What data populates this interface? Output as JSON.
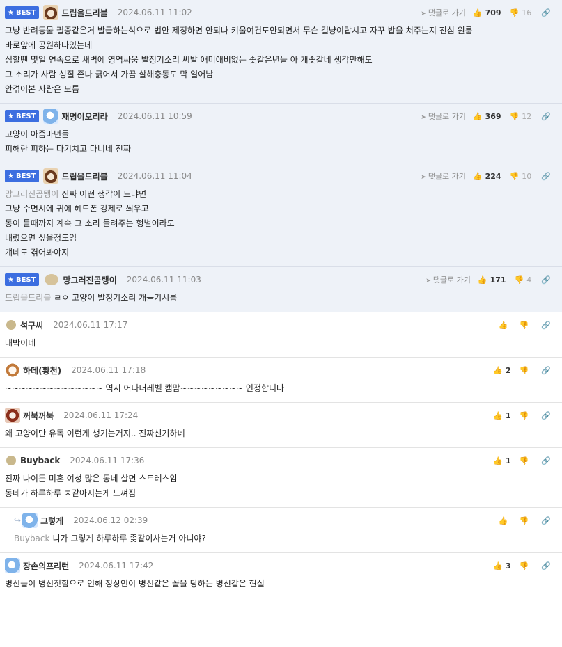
{
  "ui": {
    "best_label": "BEST",
    "goto_label": "댓글로 가기"
  },
  "comments": [
    {
      "best": true,
      "nick": "드립을드리블",
      "date": "2024.06.11 11:02",
      "up": "709",
      "down": "16",
      "lines": [
        "그냥 반려동물 필종같은거 발급하는식으로 법안 제정하면 안되나 키울여건도안되면서 무슨 길냥이랍시고 자꾸 밥을 쳐주는지 진심 원룸",
        "바로앞에 공원하나있는데",
        "심할땐 몇일 연속으로 새벽에 영역싸움 발정기소리 씨발 애미애비없는 좆같은년들 아 개좆같네 생각만해도",
        "그 소리가 사람 성질 존나 긁어서 가끔 살해충동도 막 일어남",
        "안겪어본 사람은 모름"
      ]
    },
    {
      "best": true,
      "nick": "재명이오리라",
      "date": "2024.06.11 10:59",
      "up": "369",
      "down": "12",
      "lines": [
        "고양이 아줌마년들",
        "피해란 피하는 다기치고 다니네 진짜"
      ]
    },
    {
      "best": true,
      "nick": "드립을드리블",
      "date": "2024.06.11 11:04",
      "up": "224",
      "down": "10",
      "mention": "망그러진곰탱이",
      "first_line": "진짜 어떤 생각이 드냐면",
      "lines": [
        "그냥 수면시에 귀에 헤드폰 강제로 씌우고",
        "동이 틀때까지 계속 그 소리 들려주는 형벌이라도",
        "내렸으면 싶을정도임",
        "걔네도 겪어봐야지"
      ]
    },
    {
      "best": true,
      "nick": "망그러진곰탱이",
      "date": "2024.06.11 11:03",
      "up": "171",
      "down": "4",
      "mention": "드립을드리블",
      "first_line": "ㄹㅇ 고양이 발정기소리 개듣기시름"
    },
    {
      "nick": "석구씨",
      "date": "2024.06.11 17:17",
      "lines": [
        "대박이네"
      ]
    },
    {
      "nick": "하데(황천)",
      "date": "2024.06.11 17:18",
      "up": "2",
      "lines": [
        "~~~~~~~~~~~~~~ 역시 어나더레벨 캠맘~~~~~~~~~ 인정합니다"
      ]
    },
    {
      "nick": "꺼북꺼북",
      "date": "2024.06.11 17:24",
      "up": "1",
      "lines": [
        "왜 고양이만 유독 이런게 생기는거지.. 진짜신기하네"
      ]
    },
    {
      "nick": "Buyback",
      "date": "2024.06.11 17:36",
      "up": "1",
      "lines": [
        "진짜 나이든 미혼 여성 많은 동네 살면 스트레스임",
        "동네가 하루하루 ㅈ같아지는게 느껴짐"
      ]
    },
    {
      "reply": true,
      "nick": "그렇게",
      "date": "2024.06.12 02:39",
      "mention": "Buyback",
      "first_line": "니가 그렇게 하루하루 좆같이사는거 아니야?"
    },
    {
      "nick": "장손의프리런",
      "date": "2024.06.11 17:42",
      "up": "3",
      "lines": [
        "병신들이 병신짓함으로 인해 정상인이 병신같은 꼴을 당하는 병신같은 현실"
      ]
    }
  ]
}
